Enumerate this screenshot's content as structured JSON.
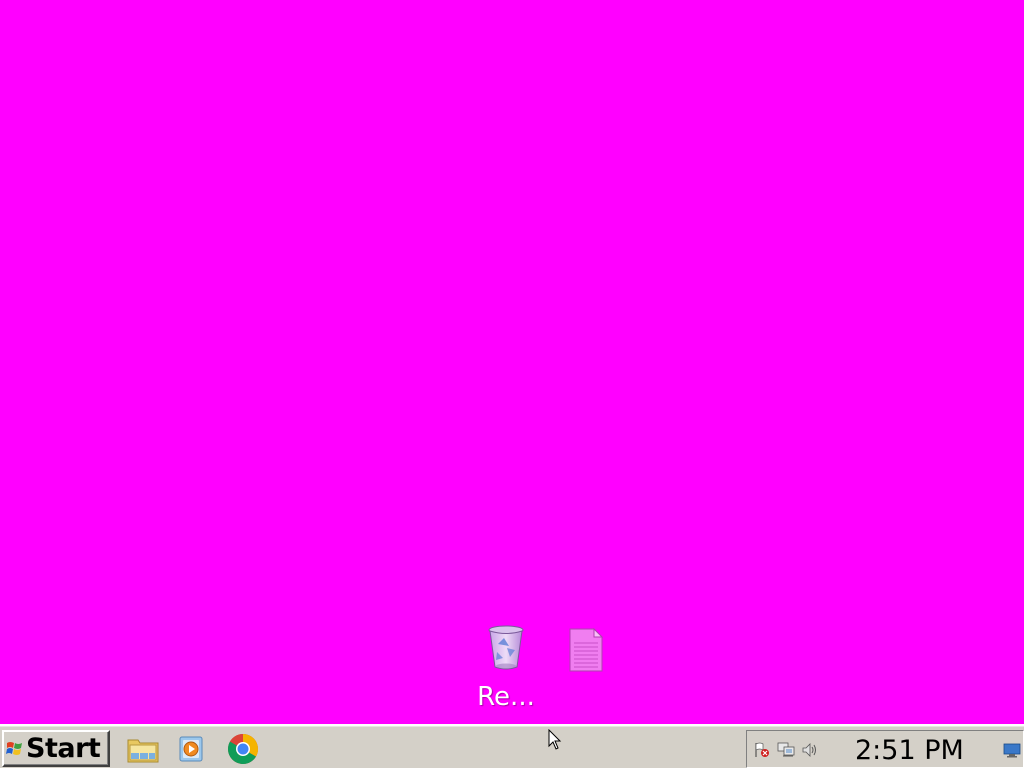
{
  "desktop": {
    "background_color": "#ff00ff",
    "icons": [
      {
        "label": "Re...",
        "icon": "recycle-bin-icon"
      },
      {
        "label": "",
        "icon": "text-document-icon"
      }
    ]
  },
  "taskbar": {
    "start_label": "Start",
    "quick_launch": [
      {
        "icon": "file-explorer-icon"
      },
      {
        "icon": "media-player-icon"
      },
      {
        "icon": "chrome-icon"
      }
    ],
    "tray": {
      "icons": [
        "action-center-flag-icon",
        "network-icon",
        "volume-icon",
        "show-desktop-icon"
      ],
      "clock": "2:51 PM"
    }
  }
}
